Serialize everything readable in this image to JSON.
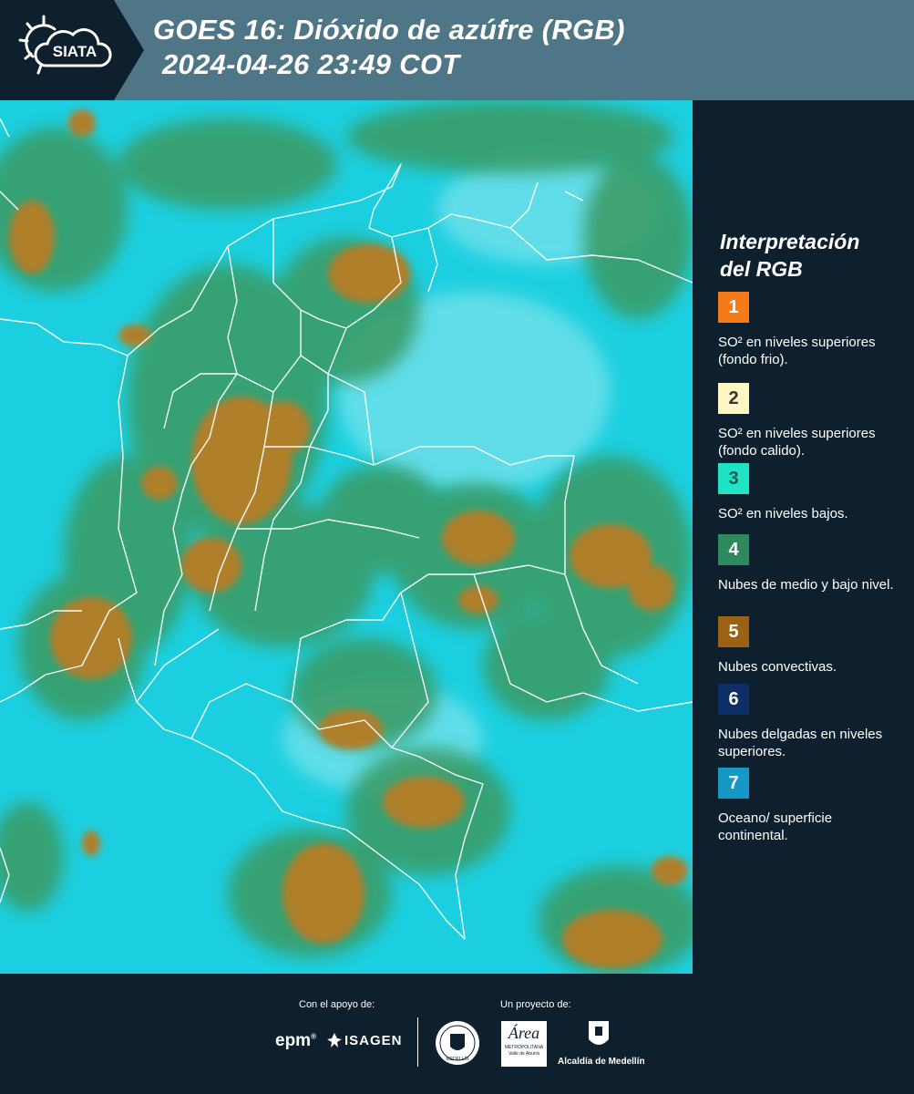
{
  "header": {
    "logo_text": "SIATA",
    "title_line1": "GOES 16: Dióxido de azúfre (RGB)",
    "title_line2": "2024-04-26 23:49 COT"
  },
  "legend": {
    "title_line1": "Interpretación",
    "title_line2": "del RGB",
    "items": [
      {
        "number": "1",
        "color": "#f47b17",
        "text_color": "#ffffff",
        "text": "SO² en niveles superiores (fondo frio)."
      },
      {
        "number": "2",
        "color": "#fdf6c3",
        "text_color": "#333333",
        "text": "SO² en niveles superiores (fondo calido)."
      },
      {
        "number": "3",
        "color": "#20e3c5",
        "text_color": "#1b5a50",
        "text": "SO² en niveles bajos."
      },
      {
        "number": "4",
        "color": "#2e8a5e",
        "text_color": "#ffffff",
        "text": "Nubes de medio y bajo nivel."
      },
      {
        "number": "5",
        "color": "#9b6214",
        "text_color": "#ffffff",
        "text": "Nubes convectivas."
      },
      {
        "number": "6",
        "color": "#0d2f66",
        "text_color": "#ffffff",
        "text": "Nubes delgadas en niveles superiores."
      },
      {
        "number": "7",
        "color": "#1598c5",
        "text_color": "#ffffff",
        "text": "Oceano/ superficie continental."
      }
    ]
  },
  "footer": {
    "support_label": "Con el apoyo de:",
    "project_label": "Un proyecto de:",
    "sponsor1": "epm",
    "sponsor2": "ISAGEN",
    "partner1": "MEDELLÍN",
    "partner2_big": "Área",
    "partner2_small": "METROPOLITANA",
    "partner2_sub": "Valle de Aburrá",
    "partner3": "Alcaldía de Medellín"
  },
  "colors": {
    "header_bg": "#4f7686",
    "background": "#0e1f2e",
    "map_sea": "#1ccfe0",
    "cloud_green": "#3a9a62",
    "cloud_brown": "#b07f2c",
    "border_white": "#ffffff"
  }
}
